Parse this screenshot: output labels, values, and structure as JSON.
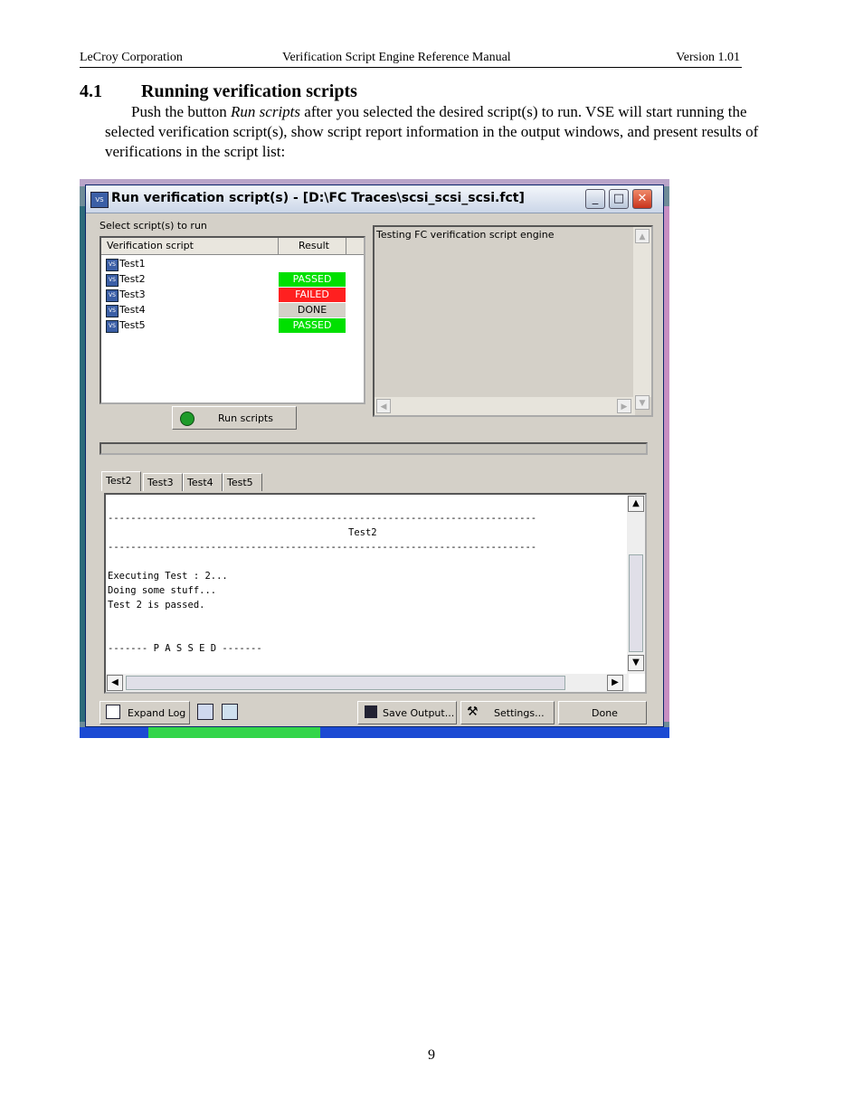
{
  "header": {
    "company": "LeCroy Corporation",
    "manual": "Verification Script Engine Reference Manual",
    "version": "Version 1.01"
  },
  "section": {
    "number": "4.1",
    "title": "Running verification scripts"
  },
  "paragraph": {
    "part1": "Push the button ",
    "italic": "Run scripts",
    "part2": " after you selected the desired script(s) to run. VSE  will start running the selected verification script(s), show script report information in the output windows, and present results of verifications in the script list:"
  },
  "page_number": "9",
  "dialog": {
    "title": "Run verification script(s) - [D:\\FC Traces\\scsi_scsi_scsi.fct]",
    "icon": "vse-app-icon",
    "select_label": "Select script(s) to run",
    "col_script": "Verification script",
    "col_result": "Result",
    "scripts": [
      {
        "name": "Test1",
        "result": "",
        "color": ""
      },
      {
        "name": "Test2",
        "result": "PASSED",
        "color": "#00e000"
      },
      {
        "name": "Test3",
        "result": "FAILED",
        "color": "#ff2020"
      },
      {
        "name": "Test4",
        "result": "DONE",
        "color": "#d4d0c8"
      },
      {
        "name": "Test5",
        "result": "PASSED",
        "color": "#00e000"
      }
    ],
    "top_output_text": "Testing FC verification script engine",
    "run_button": "Run scripts",
    "tabs": [
      "Test2",
      "Test3",
      "Test4",
      "Test5"
    ],
    "output_lines": {
      "dash1": "---------------------------------------------------------------------------",
      "heading": "Test2",
      "dash2": "---------------------------------------------------------------------------",
      "l1": "Executing Test : 2...",
      "l2": "Doing some stuff...",
      "l3": "Test 2 is passed.",
      "l4": "------- P A S S E D -------"
    },
    "expand_log": "Expand Log",
    "save_output": "Save Output...",
    "settings": "Settings...",
    "done": "Done"
  }
}
